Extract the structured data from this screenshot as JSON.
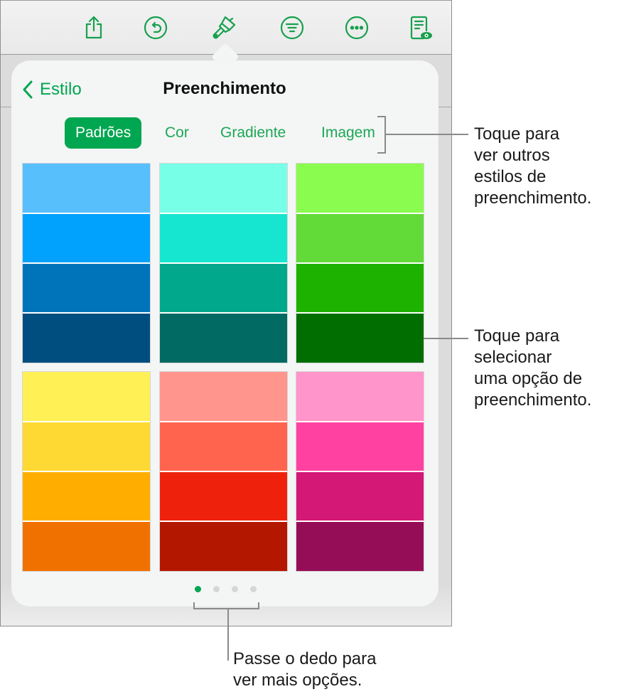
{
  "toolbar": {
    "icons": [
      {
        "name": "share-icon"
      },
      {
        "name": "undo-icon"
      },
      {
        "name": "format-brush-icon"
      },
      {
        "name": "filter-icon"
      },
      {
        "name": "more-icon"
      },
      {
        "name": "document-view-icon"
      }
    ],
    "accent_color": "#00a650"
  },
  "popover": {
    "back_label": "Estilo",
    "title": "Preenchimento",
    "tabs": [
      {
        "label": "Padrões",
        "active": true
      },
      {
        "label": "Cor",
        "active": false
      },
      {
        "label": "Gradiente",
        "active": false
      },
      {
        "label": "Imagem",
        "active": false
      }
    ],
    "swatches": [
      {
        "name": "blue",
        "colors": [
          "#58bffd",
          "#00a2fd",
          "#0074ba",
          "#004d80"
        ]
      },
      {
        "name": "teal",
        "colors": [
          "#78ffe8",
          "#16e6d0",
          "#01a88b",
          "#016a62"
        ]
      },
      {
        "name": "green",
        "colors": [
          "#8afb4f",
          "#62da38",
          "#1db100",
          "#006e00"
        ]
      },
      {
        "name": "yellow-orange",
        "colors": [
          "#fff055",
          "#ffd933",
          "#ffae00",
          "#f17100"
        ]
      },
      {
        "name": "red",
        "colors": [
          "#ff958c",
          "#ff644f",
          "#ee220c",
          "#b41700"
        ]
      },
      {
        "name": "pink",
        "colors": [
          "#ff95ca",
          "#ff42a1",
          "#d31876",
          "#960d57"
        ]
      }
    ],
    "page_indicator": {
      "total": 4,
      "current": 1
    }
  },
  "callouts": {
    "tabs_note": "Toque para\nver outros\nestilos de\npreenchimento.",
    "swatch_note": "Toque para\nselecionar\numa opção de\npreenchimento.",
    "swipe_note": "Passe o dedo para\nver mais opções."
  }
}
